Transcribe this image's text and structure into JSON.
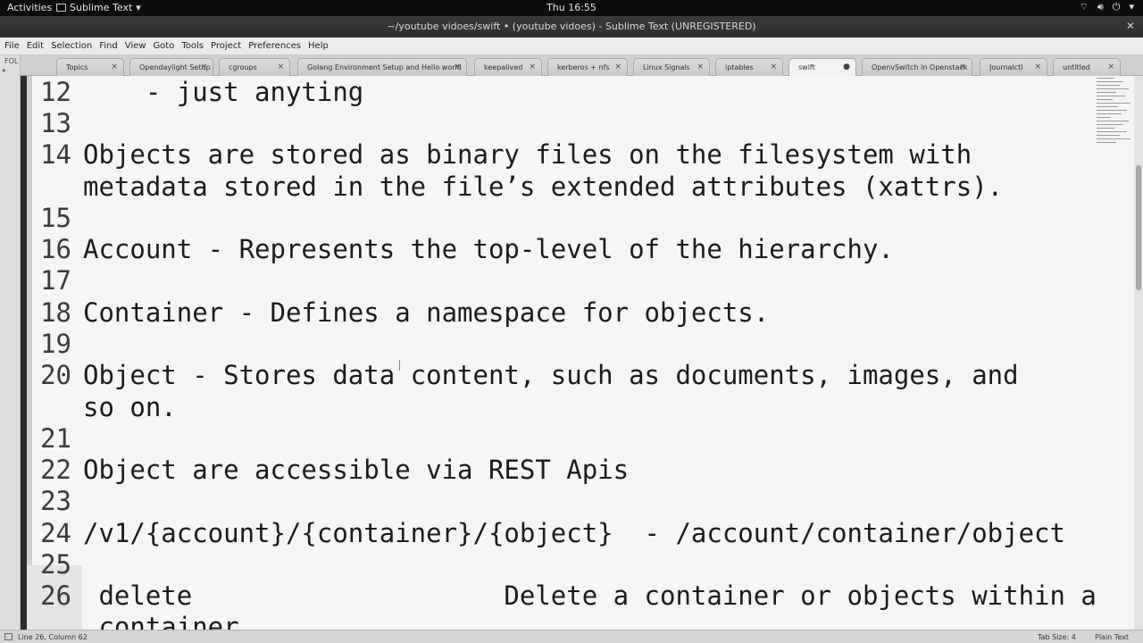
{
  "topbar": {
    "activities": "Activities",
    "app_name": "Sublime Text",
    "clock": "Thu 16:55"
  },
  "window": {
    "title": "~/youtube vidoes/swift • (youtube vidoes) - Sublime Text (UNREGISTERED)"
  },
  "menu": [
    "File",
    "Edit",
    "Selection",
    "Find",
    "View",
    "Goto",
    "Tools",
    "Project",
    "Preferences",
    "Help"
  ],
  "sidebar": {
    "label": "FOL"
  },
  "tabs": [
    {
      "label": "Topics"
    },
    {
      "label": "Opendaylight Setup"
    },
    {
      "label": "cgroups"
    },
    {
      "label": "Golang Environment Setup and Hello world"
    },
    {
      "label": "keepalived"
    },
    {
      "label": "kerberos + nfs"
    },
    {
      "label": "Linux Signals"
    },
    {
      "label": "iptables"
    },
    {
      "label": "swift"
    },
    {
      "label": "OpenvSwitch in Openstack"
    },
    {
      "label": "Journalctl"
    },
    {
      "label": "untitled"
    }
  ],
  "editor": {
    "lines": [
      {
        "num": "12",
        "text": "    - just anyting"
      },
      {
        "num": "13",
        "text": ""
      },
      {
        "num": "14",
        "text": "Objects are stored as binary files on the filesystem with"
      },
      {
        "num": "",
        "text": "metadata stored in the file’s extended attributes (xattrs)."
      },
      {
        "num": "15",
        "text": ""
      },
      {
        "num": "16",
        "text": "Account - Represents the top-level of the hierarchy."
      },
      {
        "num": "17",
        "text": ""
      },
      {
        "num": "18",
        "text": "Container - Defines a namespace for objects."
      },
      {
        "num": "19",
        "text": ""
      },
      {
        "num": "20",
        "text": "Object - Stores data content, such as documents, images, and"
      },
      {
        "num": "",
        "text": "so on."
      },
      {
        "num": "21",
        "text": ""
      },
      {
        "num": "22",
        "text": "Object are accessible via REST Apis"
      },
      {
        "num": "23",
        "text": ""
      },
      {
        "num": "24",
        "text": "/v1/{account}/{container}/{object}  - /account/container/object"
      },
      {
        "num": "25",
        "text": ""
      },
      {
        "num": "26",
        "text": " delete                    Delete a container or objects within a"
      },
      {
        "num": "",
        "text": " container"
      }
    ]
  },
  "status": {
    "position": "Line 26, Column 62",
    "tab_size": "Tab Size: 4",
    "syntax": "Plain Text"
  }
}
